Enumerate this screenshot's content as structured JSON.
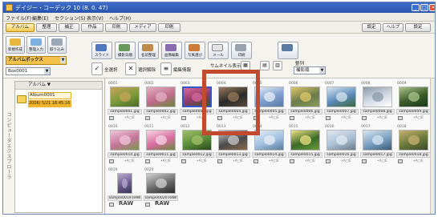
{
  "window": {
    "title": "デイジー・コーデック 10 (8. 0. 47)",
    "buttons": {
      "minimize": "_",
      "maximize": "□",
      "close": "×"
    }
  },
  "menu": [
    "ファイル(F)",
    "編集(E)",
    "セクション(S)",
    "表示(V)",
    "ヘルプ(H)"
  ],
  "tabs": {
    "left": [
      "アルバム",
      "整理",
      "補正",
      "作品",
      "印刷",
      "メディア",
      "印刷"
    ],
    "right": [
      "設定",
      "ヘルプ",
      "設定"
    ],
    "active_index": 0
  },
  "toolbar": {
    "left_tools": [
      "新規作成",
      "整理入力",
      "取り込み"
    ],
    "main_tools": [
      "スライド",
      "撮影日順",
      "名前整理",
      "画像編集",
      "写真選び",
      "メール",
      "印刷"
    ],
    "album_box_label": "アルバムボックス",
    "box_select": "Box0001",
    "sub_buttons": [
      "全選択",
      "選択解除",
      "編集情報"
    ],
    "thumbnail_label": "サムネイル表示",
    "sort_label": "整列",
    "sort_value": "撮影順"
  },
  "sidebar": {
    "vertical_label": "コンピュータエクスプローラ",
    "tree_header": "アルバム",
    "album": {
      "name": "Album0001",
      "date": "2006/ 5/21 18:45:16"
    }
  },
  "thumbnails": [
    {
      "num": "0001",
      "file": "sample0001.jpg",
      "info": "•A□E",
      "palette": [
        "#7a9a3a",
        "#c9a35a",
        "#4a6a2a"
      ]
    },
    {
      "num": "0002",
      "file": "sample0002.jpg",
      "info": "•A□E",
      "palette": [
        "#c06a8a",
        "#e2b0c2",
        "#6a8a3a"
      ]
    },
    {
      "num": "0003",
      "file": "sample0003.jpg",
      "info": "•A□E",
      "palette": [
        "#8e3a6a",
        "#d86a9a",
        "#3a5a2a"
      ],
      "selected": true
    },
    {
      "num": "0004",
      "file": "sample0004.jpg",
      "info": "•A□E",
      "palette": [
        "#2a2a2a",
        "#9a7a5a",
        "#5a4a3a"
      ]
    },
    {
      "num": "0005",
      "file": "sample0005.jpg",
      "info": "•A□E",
      "palette": [
        "#7fa0d0",
        "#e9f0f8",
        "#5a7aa8"
      ]
    },
    {
      "num": "0006",
      "file": "sample0006.jpg",
      "info": "•A□E",
      "palette": [
        "#6a7a4a",
        "#e0c86a",
        "#8aa05a"
      ]
    },
    {
      "num": "0007",
      "file": "sample0007.jpg",
      "info": "•A□E",
      "palette": [
        "#5a8ab8",
        "#d8e4ee",
        "#3a6a3a"
      ]
    },
    {
      "num": "0008",
      "file": "sample0008.jpg",
      "info": "•A□E",
      "palette": [
        "#d5dce6",
        "#8a9aaa",
        "#ffffff"
      ]
    },
    {
      "num": "0009",
      "file": "sample0009.jpg",
      "info": "•A□E",
      "palette": [
        "#3a5a2a",
        "#aac48a",
        "#1a3a1a"
      ]
    },
    {
      "num": "0010",
      "file": "sample0010.jpg",
      "info": "•A□E",
      "palette": [
        "#c4749a",
        "#f0c8d8",
        "#7a9a4a"
      ]
    },
    {
      "num": "0011",
      "file": "sample0011.jpg",
      "info": "•A□E",
      "palette": [
        "#d96aa0",
        "#f6d7e4",
        "#6a8a3a"
      ]
    },
    {
      "num": "0012",
      "file": "sample0012.jpg",
      "info": "•A□E",
      "palette": [
        "#5a8a3a",
        "#a2c26a",
        "#2a4a1a"
      ]
    },
    {
      "num": "0013",
      "file": "sample0013.jpg",
      "info": "•A□E",
      "palette": [
        "#4a4a4a",
        "#c8c8c8",
        "#8a6a4a"
      ]
    },
    {
      "num": "0014",
      "file": "sample0014.jpg",
      "info": "•A□E",
      "palette": [
        "#9fc0e0",
        "#e8eef5",
        "#5a7a9a"
      ]
    },
    {
      "num": "0015",
      "file": "sample0015.jpg",
      "info": "•A□E",
      "palette": [
        "#3a6a2a",
        "#f0e080",
        "#6a9a3a"
      ]
    },
    {
      "num": "0016",
      "file": "sample0016.jpg",
      "info": "•A□E",
      "palette": [
        "#aac0d4",
        "#e0e8f0",
        "#6a7a8a"
      ]
    },
    {
      "num": "0017",
      "file": "sample0017.jpg",
      "info": "•A□E",
      "palette": [
        "#7aa0c0",
        "#d8e6f2",
        "#3a5a7a"
      ]
    },
    {
      "num": "0018",
      "file": "sample0018.jpg",
      "info": "•A□E",
      "palette": [
        "#6a7a3a",
        "#c8b070",
        "#3a4a2a"
      ]
    },
    {
      "num": "0019",
      "file": "sample0019.RAW",
      "info": "RAW",
      "palette": [
        "#6a5a8a",
        "#b8a8d0",
        "#3a3a5a"
      ],
      "raw": true,
      "tall": true
    },
    {
      "num": "0020",
      "file": "sample0020.RAW",
      "info": "RAW",
      "palette": [
        "#6a6a6a",
        "#d0d0d0",
        "#2a2a2a"
      ],
      "raw": true
    }
  ],
  "colors": {
    "title_bar": "#2854ae",
    "active_tab": "#f3c94d",
    "selection": "#3855c8",
    "highlight_box": "#c24a2e"
  }
}
